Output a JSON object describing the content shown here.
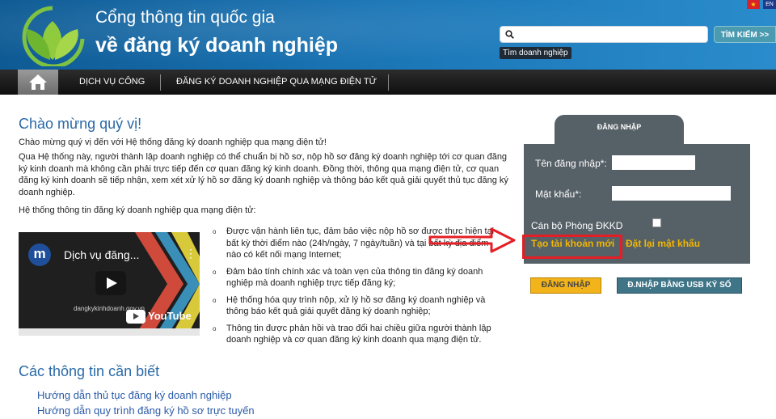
{
  "header": {
    "title_line1": "Cổng thông tin quốc gia",
    "title_line2": "về đăng ký doanh nghiệp",
    "flag_vn": "★",
    "flag_en": "EN",
    "search": {
      "value": "",
      "placeholder": "",
      "button_label": "TÌM KIẾM >>",
      "tooltip": "Tìm doanh nghiệp"
    }
  },
  "nav": {
    "home_icon": "home-icon",
    "items": [
      {
        "label": "DỊCH VỤ CÔNG"
      },
      {
        "label": "ĐĂNG KÝ DOANH NGHIỆP QUA MẠNG ĐIỆN TỬ"
      }
    ]
  },
  "main": {
    "welcome_title": "Chào mừng quý vị!",
    "paragraphs": [
      "Chào mừng quý vị đến với Hệ thống đăng ký doanh nghiệp qua mạng điện tử!",
      "Qua Hệ thống này, người thành lập doanh nghiệp có thể chuẩn bị hồ sơ, nộp hồ sơ đăng ký doanh nghiệp tới cơ quan đăng ký kinh doanh mà không cần phải trực tiếp đến cơ quan đăng ký kinh doanh. Đồng thời, thông qua mạng điện tử, cơ quan đăng ký kinh doanh sẽ tiếp nhận, xem xét xử lý hồ sơ đăng ký doanh nghiệp và thông báo kết quả giải quyết thủ tục đăng ký doanh nghiệp.",
      "Hệ thống thông tin đăng ký doanh nghiệp qua mạng điện tử:"
    ],
    "video": {
      "avatar_letter": "m",
      "title": "Dịch vụ đăng...",
      "menu": "⋮",
      "site": "dangkykinhdoanh.gov.vn",
      "brand": "YouTube"
    },
    "bullets": [
      "Được vận hành liên tục, đảm bảo việc nộp hồ sơ được thực hiện tại bất kỳ thời điểm nào (24h/ngày, 7 ngày/tuần) và tại bất kỳ địa điểm nào có kết nối mạng Internet;",
      "Đảm bảo tính chính xác và toàn vẹn của thông tin đăng ký doanh nghiệp mà doanh nghiệp trực tiếp đăng ký;",
      "Hệ thống hóa quy trình nộp, xử lý hồ sơ đăng ký doanh nghiệp và thông báo kết quả giải quyết đăng ký doanh nghiệp;",
      "Thông tin được phản hồi và trao đổi hai chiều giữa người thành lập doanh nghiệp và cơ quan đăng ký kinh doanh qua mạng điện tử."
    ],
    "bullet_marker": "o",
    "section_title": "Các thông tin cần biết",
    "links": [
      "Hướng dẫn thủ tục đăng ký doanh nghiệp",
      "Hướng dẫn quy trình đăng ký hồ sơ trực tuyến"
    ]
  },
  "login": {
    "tab_label": "ĐĂNG NHẬP",
    "username_label": "Tên đăng nhập*:",
    "username_value": "",
    "password_label": "Mật khẩu*:",
    "password_value": "",
    "staff_label": "Cán bộ Phòng ĐKKD",
    "staff_checked": false,
    "create_account": "Tạo tài khoản mới",
    "reset_password": "Đặt lại mật khẩu",
    "login_button": "ĐĂNG NHẬP",
    "usb_button": "Đ.NHẬP BẰNG USB KÝ SỐ"
  },
  "colors": {
    "header": "#1a74b4",
    "panel": "#566067",
    "accent_link": "#f2b600",
    "annotation": "#e41e24",
    "heading": "#2a6aa8"
  }
}
